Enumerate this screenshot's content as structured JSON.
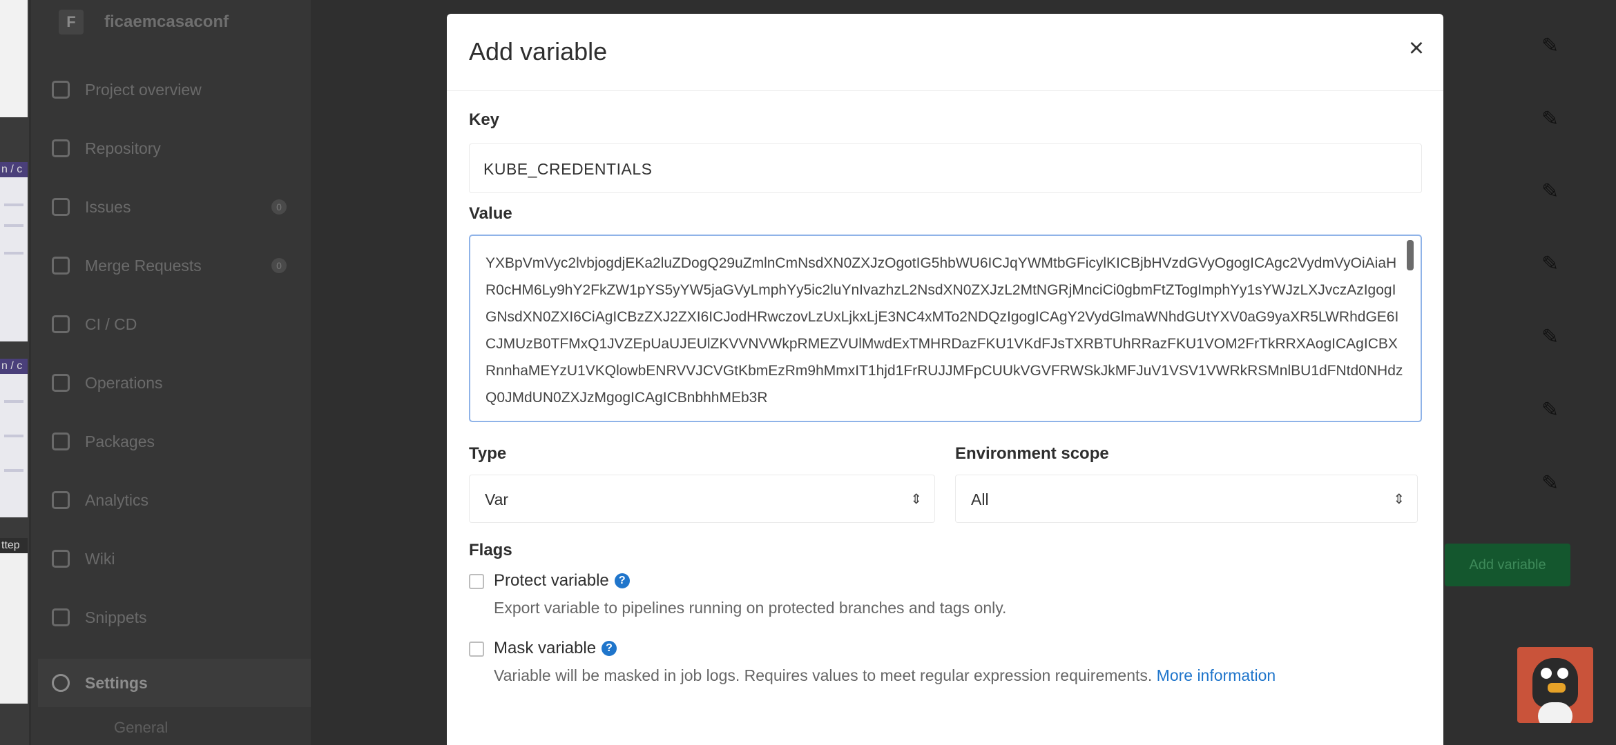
{
  "sidebar": {
    "project_avatar": "F",
    "project_name": "ficaemcasaconf",
    "items": [
      {
        "label": "Project overview",
        "icon": "home-icon"
      },
      {
        "label": "Repository",
        "icon": "book-icon"
      },
      {
        "label": "Issues",
        "icon": "issues-icon",
        "count": "0"
      },
      {
        "label": "Merge Requests",
        "icon": "merge-request-icon",
        "count": "0"
      },
      {
        "label": "CI / CD",
        "icon": "rocket-icon"
      },
      {
        "label": "Operations",
        "icon": "cloud-icon"
      },
      {
        "label": "Packages",
        "icon": "package-icon"
      },
      {
        "label": "Analytics",
        "icon": "chart-icon"
      },
      {
        "label": "Wiki",
        "icon": "book-icon"
      },
      {
        "label": "Snippets",
        "icon": "scissors-icon"
      },
      {
        "label": "Settings",
        "icon": "gear-icon"
      }
    ],
    "sub_item": "General"
  },
  "thumbnails": {
    "label_1": "n / c",
    "label_2": "n / c",
    "label_3": "ttep"
  },
  "background": {
    "add_button": "Add variable"
  },
  "modal": {
    "title": "Add variable",
    "close_label": "×",
    "key_label": "Key",
    "key_value": "KUBE_CREDENTIALS",
    "value_label": "Value",
    "value_text": "YXBpVmVyc2lvbjogdjEKa2luZDogQ29uZmlnCmNsdXN0ZXJzOgotIG5hbWU6ICJqYWMtbGFicylKICBjbHVzdGVyOgogICAgc2VydmVyOiAiaHR0cHM6Ly9hY2FkZW1pYS5yYW5jaGVyLmphYy5ic2luYnIvazhzL2NsdXN0ZXJzL2MtNGRjMnciCi0gbmFtZTogImphYy1sYWJzLXJvczAzIgogIGNsdXN0ZXI6CiAgICBzZXJ2ZXI6ICJodHRwczovLzUxLjkxLjE3NC4xMTo2NDQzIgogICAgY2VydGlmaWNhdGUtYXV0aG9yaXR5LWRhdGE6ICJMUzB0TFMxQ1JVZEpUaUJEUlZKVVNVWkpRMEZVUlMwdExTMHRDazFKU1VKdFJsTXRBTUhRRazFKU1VOM2FrTkRRXAogICAgICBXRnnhaMEYzU1VKQlowbENRVVJCVGtKbmEzRm9hMmxIT1hjd1FrRUJJMFpCUUkVGVFRWSkJkMFJuV1VSV1VWRkRSMnlBU1dFNtd0NHdzQ0JMdUN0ZXJzMgogICAgICBnbhhMEb3R",
    "type_label": "Type",
    "type_value": "Var",
    "env_label": "Environment scope",
    "env_value": "All",
    "flags_label": "Flags",
    "protect_label": "Protect variable",
    "protect_help": "Export variable to pipelines running on protected branches and tags only.",
    "mask_label": "Mask variable",
    "mask_help": "Variable will be masked in job logs. Requires values to meet regular expression requirements.",
    "more_link": "More information",
    "help_glyph": "?"
  }
}
